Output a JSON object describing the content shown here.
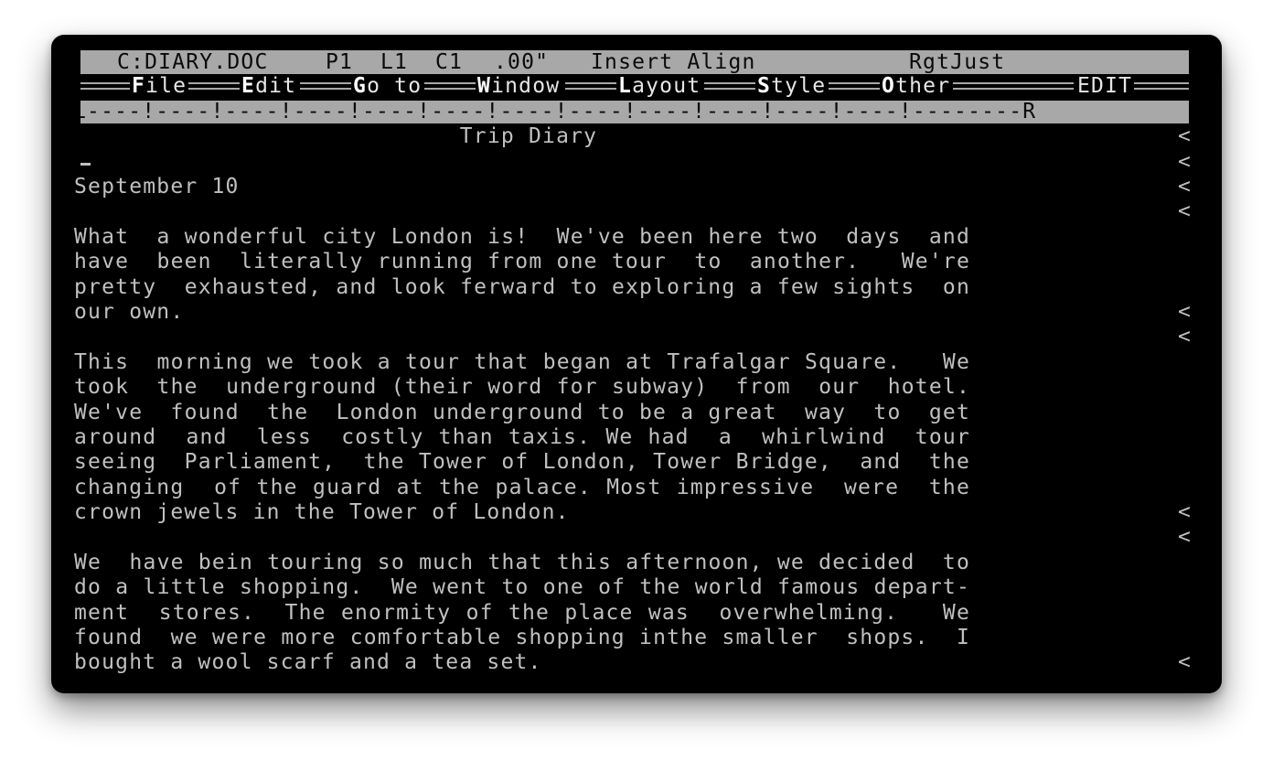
{
  "status_bar": {
    "filename": "C:DIARY.DOC",
    "page": "P1",
    "line": "L1",
    "column": "C1",
    "position": ".00\"",
    "mode": "Insert Align",
    "justification": "RgtJust"
  },
  "menu": {
    "items": [
      {
        "hot": "F",
        "rest": "ile"
      },
      {
        "hot": "E",
        "rest": "dit"
      },
      {
        "hot": "G",
        "rest": "o to"
      },
      {
        "hot": "W",
        "rest": "indow"
      },
      {
        "hot": "L",
        "rest": "ayout"
      },
      {
        "hot": "S",
        "rest": "tyle"
      },
      {
        "hot": "O",
        "rest": "ther"
      }
    ],
    "mode_label": "EDIT"
  },
  "ruler": {
    "text": "L----!----!----!----!----!----!----!----!----!----!----!----!--------R"
  },
  "document": {
    "title": "Trip Diary",
    "date": "September 10",
    "para1": [
      "What  a wonderful city London is!  We've been here two  days  and",
      "have  been  literally running from one tour  to  another.   We're",
      "pretty  exhausted, and look ferward to exploring a few sights  on",
      "our own."
    ],
    "para2": [
      "This  morning we took a tour that began at Trafalgar Square.   We",
      "took  the  underground (their word for subway)  from  our  hotel.",
      "We've  found  the  London underground to be a great  way  to  get",
      "around  and  less  costly than taxis. We had  a  whirlwind  tour",
      "seeing  Parliament,  the Tower of London, Tower Bridge,  and  the",
      "changing  of the guard at the palace. Most impressive  were  the",
      "crown jewels in the Tower of London."
    ],
    "para3": [
      "We  have bein touring so much that this afternoon, we decided  to",
      "do a little shopping.  We went to one of the world famous depart-",
      "ment  stores.  The enormity of the place was  overwhelming.   We",
      "found  we were more comfortable shopping inthe smaller  shops.  I",
      "bought a wool scarf and a tea set."
    ],
    "paragraph_mark": "<"
  }
}
